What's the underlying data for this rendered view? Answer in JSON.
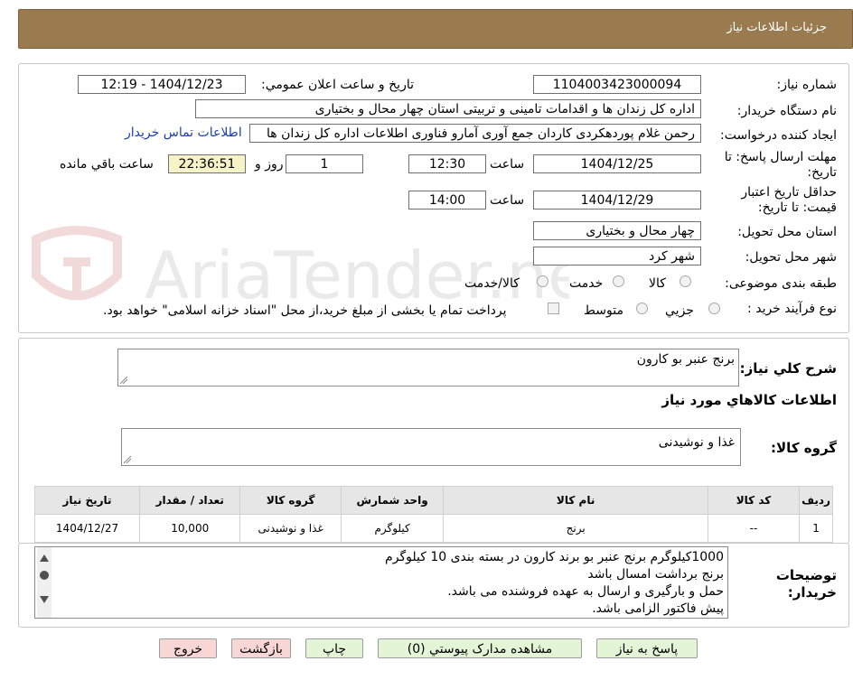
{
  "header": {
    "title": "جزئیات اطلاعات نیاز"
  },
  "labels": {
    "need_number": "شماره نیاز:",
    "announce": "تاریخ و ساعت اعلان عمومي:",
    "buyer_org": "نام دستگاه خریدار:",
    "requester": "ایجاد کننده درخواست:",
    "deadline": "مهلت ارسال پاسخ: تا تاریخ:",
    "min_validity": "حداقل تاریخ اعتبار قیمت: تا تاریخ:",
    "province": "استان محل تحویل:",
    "city": "شهر محل تحویل:",
    "category": "طبقه بندی موضوعی:",
    "purchase_type": "نوع فرآیند خرید :",
    "time": "ساعت",
    "day_and": "روز و",
    "remaining": "ساعت باقي مانده",
    "desc": "شرح کلي نياز:",
    "goods_info": "اطلاعات کالاهاي مورد نياز",
    "goods_group": "گروه کالا:",
    "buyer_notes": "توضیحات خریدار:"
  },
  "fields": {
    "need_number": "1104003423000094",
    "announce_datetime": "1404/12/23 - 12:19",
    "buyer_org": "اداره کل زندان ها و اقدامات تامینی و تربیتی استان چهار محال و بختیاری",
    "requester": "رحمن غلام پوردهکردی کاردان جمع آوری آمارو فناوری اطلاعات اداره کل زندان ها",
    "contact_link": "اطلاعات تماس خریدار",
    "deadline_date": "1404/12/25",
    "deadline_time": "12:30",
    "days": "1",
    "remaining_time": "22:36:51",
    "validity_date": "1404/12/29",
    "validity_time": "14:00",
    "province": "چهار محال و بختیاری",
    "city": "شهر کرد",
    "category_options": [
      "کالا",
      "خدمت",
      "کالا/خدمت"
    ],
    "purchase_options": [
      "جزیي",
      "متوسط"
    ],
    "payment_note": "پرداخت تمام یا بخشی از مبلغ خرید،از محل \"اسناد خزانه اسلامی\" خواهد بود."
  },
  "description": "برنج عنبر بو کارون",
  "goods_group": "غذا و نوشیدنی",
  "table": {
    "headers": [
      "ردیف",
      "کد کالا",
      "نام کالا",
      "واحد شمارش",
      "گروه کالا",
      "تعداد / مقدار",
      "تاریخ نیاز"
    ],
    "rows": [
      [
        "1",
        "--",
        "برنج",
        "کیلوگرم",
        "غذا و نوشیدنی",
        "10,000",
        "1404/12/27"
      ]
    ]
  },
  "notes": [
    "1000کیلوگرم برنج عنبر بو برند کارون در بسته بندی 10 کیلوگرم",
    "برنج برداشت امسال باشد",
    "حمل و بارگیری و ارسال به عهده فروشنده می باشد.",
    "پیش فاکتور الزامی باشد."
  ],
  "buttons": {
    "reply": "پاسخ به نیاز",
    "view_docs": "مشاهده مدارک پیوستي (0)",
    "print": "چاپ",
    "back": "بازگشت",
    "exit": "خروج"
  },
  "watermark": "AriaTender.neT"
}
